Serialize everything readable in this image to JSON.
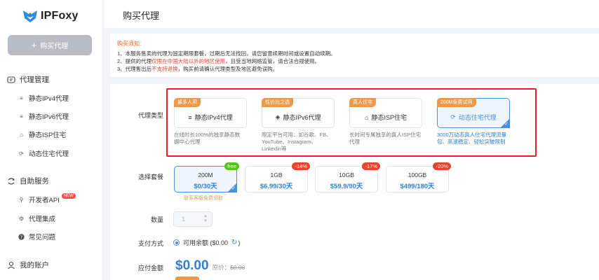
{
  "sidebar": {
    "logo_text": "IPFoxy",
    "buy_button": "购买代理",
    "groups": [
      {
        "label": "代理管理",
        "icon": "proxy-manage-icon",
        "items": [
          {
            "label": "静态IPv4代理",
            "icon": "list-icon"
          },
          {
            "label": "静态IPv6代理",
            "icon": "list-icon"
          },
          {
            "label": "静态ISP住宅",
            "icon": "home-icon"
          },
          {
            "label": "动态住宅代理",
            "icon": "refresh-icon"
          }
        ]
      },
      {
        "label": "自助服务",
        "icon": "self-service-icon",
        "items": [
          {
            "label": "开发者API",
            "icon": "api-icon",
            "badge": "NEW"
          },
          {
            "label": "代理集成",
            "icon": "gear-icon"
          },
          {
            "label": "常见问题",
            "icon": "question-icon"
          }
        ]
      },
      {
        "label": "我的账户",
        "icon": "user-icon",
        "items": []
      }
    ]
  },
  "header": {
    "title": "购买代理"
  },
  "notice": {
    "title": "购买须知:",
    "lines": [
      {
        "pre": "1、本服务售卖的代理为固定期限套餐，过期后无法找回，请您留意续期时间或设置自动续期。",
        "red": "",
        "post": ""
      },
      {
        "pre": "2、提供的代理",
        "red": "仅限在中国大陆以外的地区使用",
        "post": "，且受当地网络监管，请合法合规使用。"
      },
      {
        "pre": "3、代理售出后",
        "red": "不支持退换",
        "post": "，购买前请确认代理类型及地区避免误购。"
      }
    ]
  },
  "form": {
    "proxy_type_label": "代理类型",
    "plan_label": "选择套餐",
    "qty_label": "数量",
    "pay_label": "支付方式",
    "total_label": "应付金额"
  },
  "proxy_types": [
    {
      "tag": "最多人用",
      "name": "静态IPv4代理",
      "icon": "list-icon",
      "desc": [
        "在线时长100%的独享静态数",
        "据中心代理"
      ],
      "selected": false
    },
    {
      "tag": "性价比之选",
      "name": "静态IPv6代理",
      "icon": "layers-icon",
      "desc": [
        "限定平台可用：如谷歌、FB、",
        "YouTube、Instagram、",
        "Linkedin等"
      ],
      "selected": false
    },
    {
      "tag": "真人住宅",
      "name": "静态ISP住宅",
      "icon": "home-icon",
      "desc": [
        "长时间专属独享的真人ISP住宅",
        "代理"
      ],
      "selected": false
    },
    {
      "tag": "200M免费试用",
      "name": "动态住宅代理",
      "icon": "refresh-icon",
      "desc": [
        "3000万动态真人住宅代理流量",
        "包、高速稳定、轻松突破限制"
      ],
      "selected": true
    }
  ],
  "plans": [
    {
      "size": "200M",
      "price": "$0/30天",
      "tag": "free",
      "selected": true
    },
    {
      "size": "1GB",
      "price": "$6.99/30天",
      "tag": "-14%",
      "selected": false
    },
    {
      "size": "10GB",
      "price": "$59.9/90天",
      "tag": "-17%",
      "selected": false
    },
    {
      "size": "100GB",
      "price": "$499/180天",
      "tag": "-20%",
      "selected": false
    }
  ],
  "plan_note": "联系客服免费领取",
  "quantity": {
    "value": "1"
  },
  "payment": {
    "option": "可用余额 ($0.00",
    "suffix": ")"
  },
  "total": {
    "amount": "$0.00",
    "orig_label": "原价：",
    "orig_value": "$0.00"
  },
  "colors": {
    "accent": "#4a90e2",
    "highlight": "#e3202b",
    "tag_orange": "#f0984a",
    "discount_red": "#e8432c",
    "free_green": "#52c41a"
  }
}
